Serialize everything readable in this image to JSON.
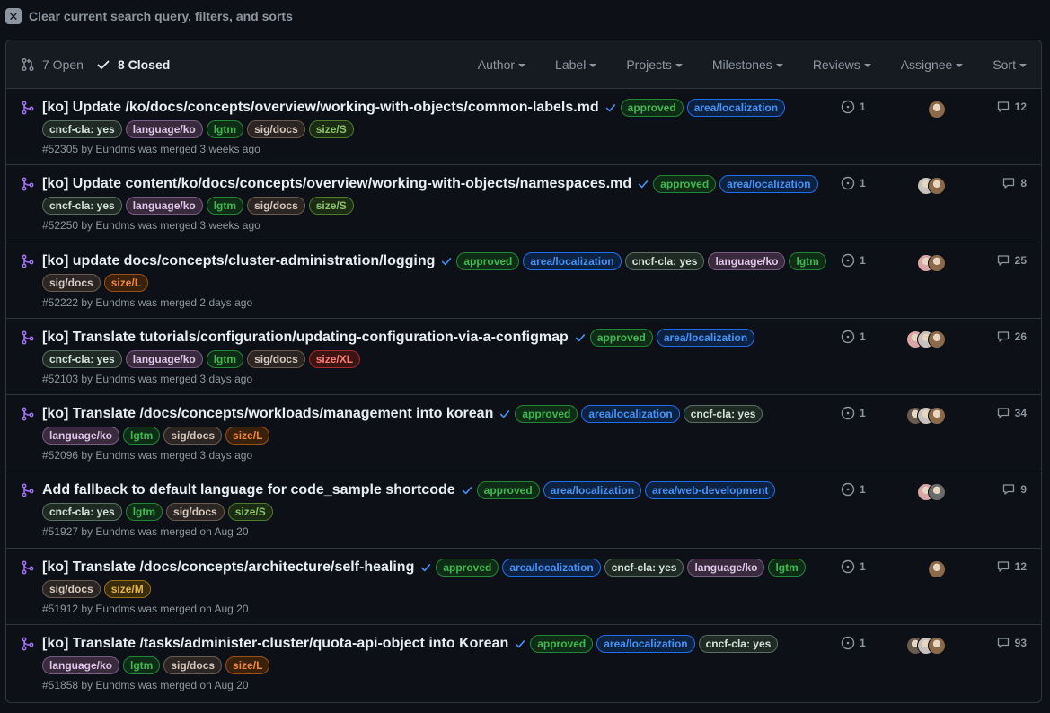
{
  "clear_text": "Clear current search query, filters, and sorts",
  "header": {
    "open_label": "7 Open",
    "closed_label": "8 Closed",
    "filters": [
      "Author",
      "Label",
      "Projects",
      "Milestones",
      "Reviews",
      "Assignee",
      "Sort"
    ]
  },
  "label_colors": {
    "approved": {
      "bg": "#0f2c17",
      "fg": "#3fb950",
      "border": "#238636"
    },
    "area/localization": {
      "bg": "#0d2240",
      "fg": "#4493f8",
      "border": "#1f6feb"
    },
    "area/web-development": {
      "bg": "#0d2240",
      "fg": "#4493f8",
      "border": "#1f6feb"
    },
    "cncf-cla: yes": {
      "bg": "#1f2a24",
      "fg": "#d1e3d9",
      "border": "#58705f"
    },
    "language/ko": {
      "bg": "#3a2a3d",
      "fg": "#dfc6e9",
      "border": "#7a5a86"
    },
    "lgtm": {
      "bg": "#0f2c17",
      "fg": "#3fb950",
      "border": "#238636"
    },
    "sig/docs": {
      "bg": "#2b2623",
      "fg": "#d6c7bd",
      "border": "#6a5a4f"
    },
    "size/S": {
      "bg": "#1b2b14",
      "fg": "#8cc265",
      "border": "#4e7a2e"
    },
    "size/L": {
      "bg": "#3a210c",
      "fg": "#f0883e",
      "border": "#9a4f15"
    },
    "size/M": {
      "bg": "#3a2d0c",
      "fg": "#e3b341",
      "border": "#9a6f15"
    },
    "size/XL": {
      "bg": "#3d1414",
      "fg": "#ff7b72",
      "border": "#a12a2a"
    }
  },
  "prs": [
    {
      "title": "[ko] Update /ko/docs/concepts/overview/working-with-objects/common-labels.md",
      "labels": [
        "approved",
        "area/localization",
        "cncf-cla: yes",
        "language/ko",
        "lgtm",
        "sig/docs",
        "size/S"
      ],
      "meta": "#52305 by Eundms was merged 3 weeks ago",
      "checks": "1",
      "comments": "12",
      "avatar_colors": [
        "#8a6a4a"
      ]
    },
    {
      "title": "[ko] Update content/ko/docs/concepts/overview/working-with-objects/namespaces.md",
      "labels": [
        "approved",
        "area/localization",
        "cncf-cla: yes",
        "language/ko",
        "lgtm",
        "sig/docs",
        "size/S"
      ],
      "meta": "#52250 by Eundms was merged 3 weeks ago",
      "checks": "1",
      "comments": "8",
      "avatar_colors": [
        "#8a6a4a",
        "#c7c2bd"
      ]
    },
    {
      "title": "[ko] update docs/concepts/cluster-administration/logging",
      "labels": [
        "approved",
        "area/localization",
        "cncf-cla: yes",
        "language/ko",
        "lgtm",
        "sig/docs",
        "size/L"
      ],
      "meta": "#52222 by Eundms was merged 2 days ago",
      "checks": "1",
      "comments": "25",
      "avatar_colors": [
        "#8a6a4a",
        "#d9a6a6"
      ]
    },
    {
      "title": "[ko] Translate tutorials/configuration/updating-configuration-via-a-configmap",
      "labels": [
        "approved",
        "area/localization",
        "cncf-cla: yes",
        "language/ko",
        "lgtm",
        "sig/docs",
        "size/XL"
      ],
      "meta": "#52103 by Eundms was merged 3 days ago",
      "checks": "1",
      "comments": "26",
      "avatar_colors": [
        "#8a6a4a",
        "#c7c2bd",
        "#d9a6a6"
      ]
    },
    {
      "title": "[ko] Translate /docs/concepts/workloads/management into korean",
      "labels": [
        "approved",
        "area/localization",
        "cncf-cla: yes",
        "language/ko",
        "lgtm",
        "sig/docs",
        "size/L"
      ],
      "meta": "#52096 by Eundms was merged 3 days ago",
      "checks": "1",
      "comments": "34",
      "avatar_colors": [
        "#8a6a4a",
        "#c7c2bd",
        "#6a5a4f"
      ]
    },
    {
      "title": "Add fallback to default language for code_sample shortcode",
      "labels": [
        "approved",
        "area/localization",
        "area/web-development",
        "cncf-cla: yes",
        "lgtm",
        "sig/docs",
        "size/S"
      ],
      "meta": "#51927 by Eundms was merged on Aug 20",
      "checks": "1",
      "comments": "9",
      "avatar_colors": [
        "#6b6b6b",
        "#d9a6a6"
      ]
    },
    {
      "title": "[ko] Translate /docs/concepts/architecture/self-healing",
      "labels": [
        "approved",
        "area/localization",
        "cncf-cla: yes",
        "language/ko",
        "lgtm",
        "sig/docs",
        "size/M"
      ],
      "meta": "#51912 by Eundms was merged on Aug 20",
      "checks": "1",
      "comments": "12",
      "avatar_colors": [
        "#8a6a4a"
      ]
    },
    {
      "title": "[ko] Translate /tasks/administer-cluster/quota-api-object into Korean",
      "labels": [
        "approved",
        "area/localization",
        "cncf-cla: yes",
        "language/ko",
        "lgtm",
        "sig/docs",
        "size/L"
      ],
      "meta": "#51858 by Eundms was merged on Aug 20",
      "checks": "1",
      "comments": "93",
      "avatar_colors": [
        "#8a6a4a",
        "#c7c2bd",
        "#6a5a4f"
      ]
    }
  ]
}
